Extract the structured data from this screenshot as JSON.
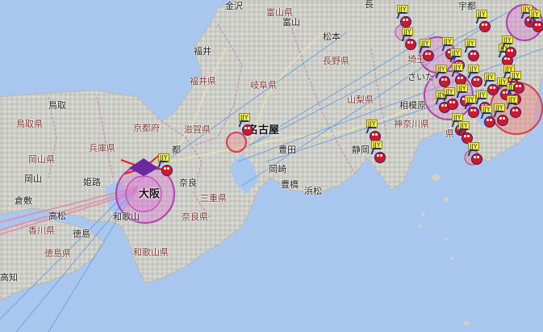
{
  "map": {
    "prefecture_labels": [
      "金沢",
      "富山県",
      "富山",
      "長野県",
      "福井",
      "福井県",
      "岐阜県",
      "鳥取県",
      "鳥取",
      "京都府",
      "滋賀県",
      "兵庫県",
      "岡山県",
      "岡山",
      "倉敷",
      "姫路",
      "都",
      "奈良",
      "三重県",
      "奈良県",
      "和歌山",
      "和歌山県",
      "香川県",
      "高松",
      "徳島",
      "徳島県",
      "高知",
      "静岡",
      "浜松",
      "豊橋",
      "岡崎",
      "豊田",
      "山梨県",
      "相模原",
      "神奈川県",
      "さいた",
      "宇都",
      "松本",
      "埼玉",
      "県",
      "長"
    ],
    "major_city_labels": [
      "名古屋",
      "大阪"
    ],
    "marker_label": "JJY",
    "marker_count": 34
  }
}
